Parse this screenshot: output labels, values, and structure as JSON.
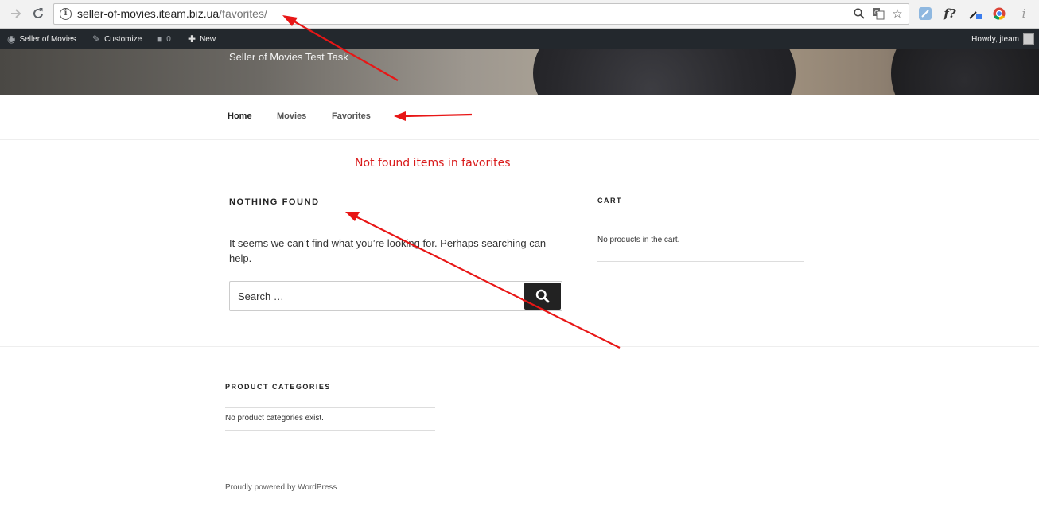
{
  "browser": {
    "url_host": "seller-of-movies.iteam.biz.ua",
    "url_path": "/favorites/",
    "icons": {
      "forward": "arrow-right-icon",
      "reload": "reload-icon",
      "site_info": "info-icon",
      "zoom": "magnifier-icon",
      "translate": "translate-icon",
      "bookmark": "star-icon"
    },
    "extensions": [
      "extension-icon-1",
      "f?",
      "eyedropper-icon",
      "chrome-extension-icon",
      "info-italic-icon"
    ]
  },
  "admin_bar": {
    "site_name": "Seller of Movies",
    "customize": "Customize",
    "comments_count": "0",
    "new_label": "New",
    "howdy": "Howdy, jteam"
  },
  "header": {
    "description": "Seller of Movies Test Task"
  },
  "menu": {
    "items": [
      {
        "label": "Home"
      },
      {
        "label": "Movies"
      },
      {
        "label": "Favorites"
      }
    ]
  },
  "content": {
    "notice": "Not found items in favorites",
    "title": "NOTHING FOUND",
    "text": "It seems we can’t find what you’re looking for. Perhaps searching can help.",
    "search_placeholder": "Search …"
  },
  "sidebar": {
    "cart_title": "CART",
    "cart_empty": "No products in the cart."
  },
  "footer": {
    "categories_title": "PRODUCT CATEGORIES",
    "categories_empty": "No product categories exist.",
    "powered_by": "Proudly powered by WordPress"
  },
  "colors": {
    "annotation_red": "#e81616",
    "admin_bar_bg": "#23282d",
    "notice_red": "#d91a1a"
  }
}
